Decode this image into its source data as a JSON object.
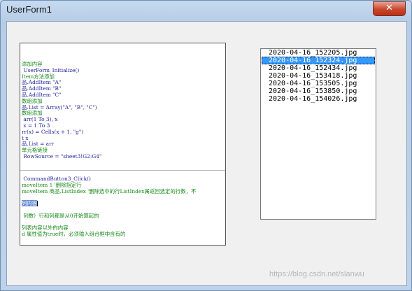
{
  "window": {
    "title": "UserForm1",
    "close_glyph": "✕"
  },
  "image": {
    "code_lines_top": [
      {
        "text": "添加内容",
        "cls": "c"
      },
      {
        "text": " UserForm_Initialize()",
        "cls": "k"
      },
      {
        "text": "Item方法添加",
        "cls": "c"
      },
      {
        "text": "品.AddItem \"A\"",
        "cls": "k"
      },
      {
        "text": "品.AddItem \"B\"",
        "cls": "k"
      },
      {
        "text": "品.AddItem \"C\"",
        "cls": "k"
      },
      {
        "text": "数组添加",
        "cls": "c"
      },
      {
        "text": "品.List = Array(\"A\", \"B\", \"C\")",
        "cls": "k"
      },
      {
        "text": "数组添加",
        "cls": "c"
      },
      {
        "text": " arr(1 To 3), x",
        "cls": "k"
      },
      {
        "text": " x = 1 To 3",
        "cls": "k"
      },
      {
        "text": "rr(x) = Cells(x + 1, \"g\")",
        "cls": "k"
      },
      {
        "text": "t x",
        "cls": "k"
      },
      {
        "text": "品.List = arr",
        "cls": "k"
      },
      {
        "text": "单元格链接",
        "cls": "c"
      },
      {
        "text": " RowSource = \"sheet3!G2:G4\"",
        "cls": "k"
      }
    ],
    "code_lines_bottom": [
      {
        "text": " CommandButton3_Click()",
        "cls": "k"
      },
      {
        "text": "moveItem 1 '删除指定行",
        "cls": "c"
      },
      {
        "text": "moveItem 商品.ListIndex '删除选中的行ListIndex属返回选定的行数，不",
        "cls": "c"
      },
      {
        "text": "",
        "cls": "k"
      },
      {
        "text": "",
        "cls": "k"
      },
      {
        "text": "",
        "cls": "k"
      },
      {
        "text": " 列数）行和列都是从0开始算起的",
        "cls": "c"
      },
      {
        "text": "",
        "cls": "k"
      },
      {
        "text": "列表内容以外的内容",
        "cls": "c"
      },
      {
        "text": "d 属性值为true时，必须输入组合框中含有的",
        "cls": "c"
      }
    ],
    "highlight_text": "列内容"
  },
  "listbox": {
    "items": [
      "2020-04-16_152205.jpg",
      "2020-04-16_152324.jpg",
      "2020-04-16_152434.jpg",
      "2020-04-16_153418.jpg",
      "2020-04-16_153505.jpg",
      "2020-04-16_153850.jpg",
      "2020-04-16_154026.jpg"
    ],
    "selected_index": 1
  },
  "watermark": "https://blog.csdn.net/slanwu"
}
